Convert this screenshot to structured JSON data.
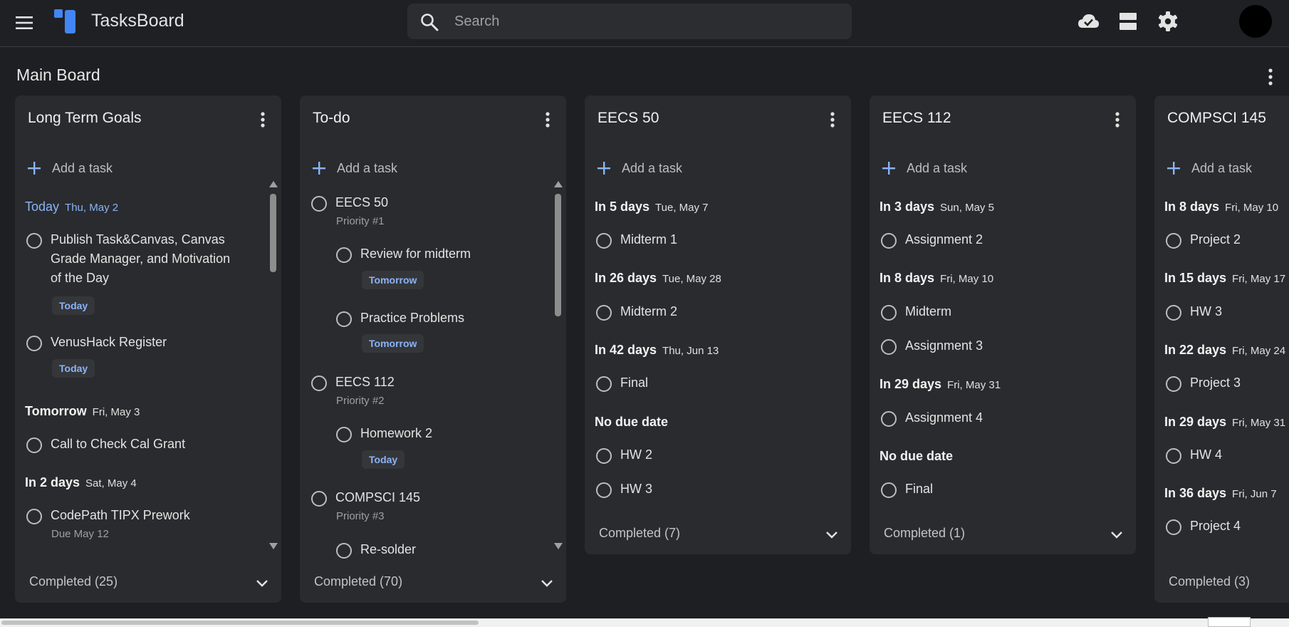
{
  "app": {
    "title": "TasksBoard"
  },
  "search": {
    "placeholder": "Search"
  },
  "icons": {
    "menu": "hamburger-menu-icon",
    "search": "search-icon",
    "cloud": "cloud-done-icon",
    "layout": "view-agenda-icon",
    "settings": "gear-icon",
    "more": "more-vert-icon",
    "add": "plus-icon",
    "chevron": "chevron-down-icon"
  },
  "colors": {
    "accent": "#8ab4f8",
    "logo": "#4285f4",
    "background": "#1e1f22",
    "card": "#2a2b2e"
  },
  "board": {
    "title": "Main Board"
  },
  "common": {
    "add_task": "Add a task"
  },
  "columns": [
    {
      "title": "Long Term Goals",
      "completed": "Completed (25)",
      "sections": [
        {
          "label": "Today",
          "date": "Thu, May 2"
        },
        {
          "label": "Tomorrow",
          "date": "Fri, May 3"
        },
        {
          "label": "In 2 days",
          "date": "Sat, May 4"
        }
      ],
      "tasks": [
        {
          "text": "Publish Task&Canvas, Canvas Grade Manager, and Motivation of the Day",
          "chip": "Today"
        },
        {
          "text": "VenusHack Register",
          "chip": "Today"
        },
        {
          "text": "Call to Check Cal Grant"
        },
        {
          "text": "CodePath TIPX Prework",
          "sub": "Due May 12"
        }
      ]
    },
    {
      "title": "To-do",
      "completed": "Completed (70)",
      "tasks": [
        {
          "text": "EECS 50",
          "sub": "Priority #1"
        },
        {
          "text": "Review for midterm",
          "chip": "Tomorrow"
        },
        {
          "text": "Practice Problems",
          "chip": "Tomorrow"
        },
        {
          "text": "EECS 112",
          "sub": "Priority #2"
        },
        {
          "text": "Homework 2",
          "chip": "Today"
        },
        {
          "text": "COMPSCI 145",
          "sub": "Priority #3"
        },
        {
          "text": "Re-solder"
        }
      ]
    },
    {
      "title": "EECS 50",
      "completed": "Completed (7)",
      "sections": [
        {
          "label": "In 5 days",
          "date": "Tue, May 7"
        },
        {
          "label": "In 26 days",
          "date": "Tue, May 28"
        },
        {
          "label": "In 42 days",
          "date": "Thu, Jun 13"
        },
        {
          "label": "No due date",
          "date": ""
        }
      ],
      "tasks": [
        {
          "text": "Midterm 1"
        },
        {
          "text": "Midterm 2"
        },
        {
          "text": "Final"
        },
        {
          "text": "HW 2"
        },
        {
          "text": "HW 3"
        }
      ]
    },
    {
      "title": "EECS 112",
      "completed": "Completed (1)",
      "sections": [
        {
          "label": "In 3 days",
          "date": "Sun, May 5"
        },
        {
          "label": "In 8 days",
          "date": "Fri, May 10"
        },
        {
          "label": "In 29 days",
          "date": "Fri, May 31"
        },
        {
          "label": "No due date",
          "date": ""
        }
      ],
      "tasks": [
        {
          "text": "Assignment 2"
        },
        {
          "text": "Midterm"
        },
        {
          "text": "Assignment 3"
        },
        {
          "text": "Assignment 4"
        },
        {
          "text": "Final"
        }
      ]
    },
    {
      "title": "COMPSCI 145",
      "completed": "Completed (3)",
      "sections": [
        {
          "label": "In 8 days",
          "date": "Fri, May 10"
        },
        {
          "label": "In 15 days",
          "date": "Fri, May 17"
        },
        {
          "label": "In 22 days",
          "date": "Fri, May 24"
        },
        {
          "label": "In 29 days",
          "date": "Fri, May 31"
        },
        {
          "label": "In 36 days",
          "date": "Fri, Jun 7"
        }
      ],
      "tasks": [
        {
          "text": "Project 2"
        },
        {
          "text": "HW 3"
        },
        {
          "text": "Project 3"
        },
        {
          "text": "HW 4"
        },
        {
          "text": "Project 4"
        }
      ]
    }
  ]
}
